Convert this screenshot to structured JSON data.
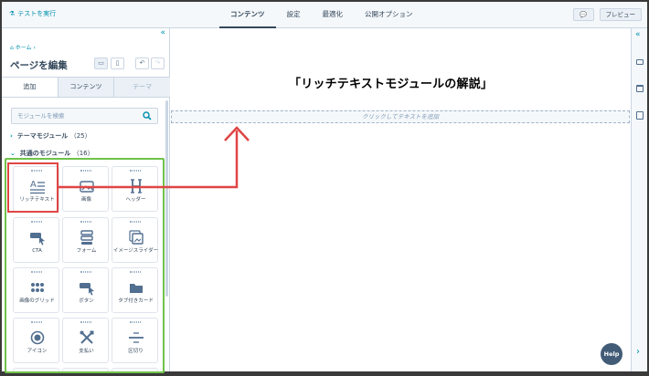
{
  "topbar": {
    "test_label": "テストを実行",
    "tabs": [
      "コンテンツ",
      "設定",
      "最適化",
      "公開オプション"
    ],
    "preview_label": "プレビュー"
  },
  "panel": {
    "breadcrumb": "ホーム ›",
    "title": "ページを編集",
    "tabs": [
      "追加",
      "コンテンツ",
      "テーマ"
    ],
    "search_placeholder": "モジュールを検索",
    "group_theme": {
      "label": "テーマモジュール",
      "count": "（25）"
    },
    "group_common": {
      "label": "共通のモジュール",
      "count": "（16）"
    },
    "modules": [
      "リッチテキスト",
      "画像",
      "ヘッダー",
      "CTA",
      "フォーム",
      "イメージスライダー",
      "画像のグリッド",
      "ボタン",
      "タブ付きカード",
      "アイコン",
      "支払い",
      "区切り"
    ]
  },
  "canvas": {
    "headline": "「リッチテキストモジュールの解説」",
    "add_text": "クリックしてテキストを追加"
  },
  "help_label": "Help",
  "colors": {
    "accent": "#0091ae",
    "green_highlight": "#6fc24a",
    "red_highlight": "#e04545"
  }
}
